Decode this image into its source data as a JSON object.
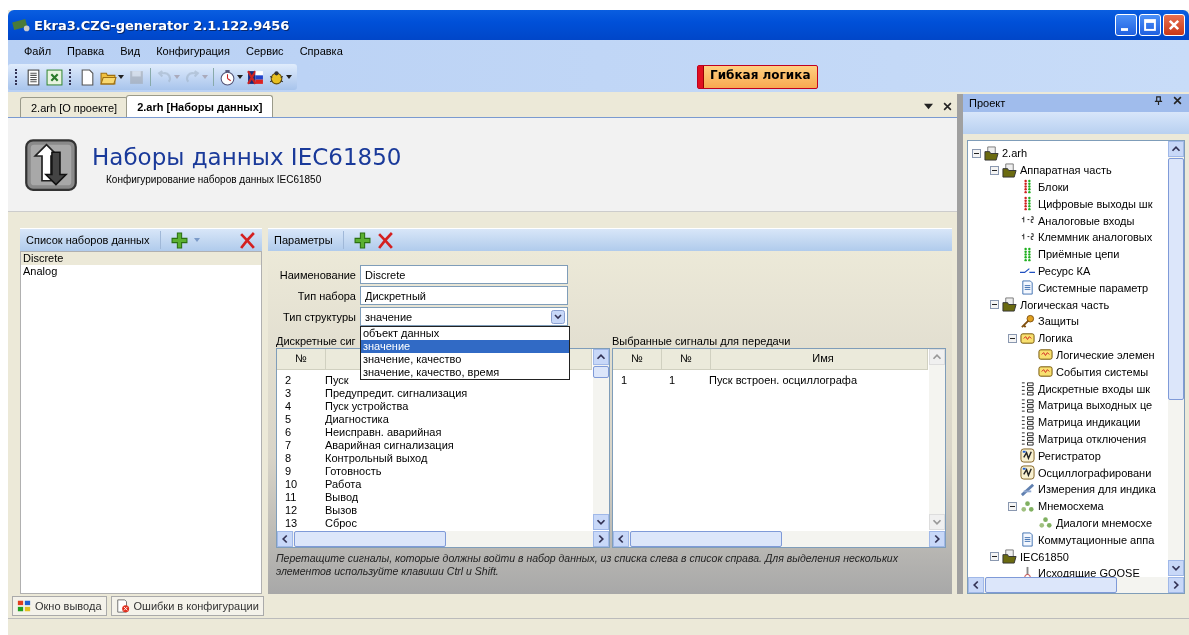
{
  "window": {
    "title": "Ekra3.CZG-generator 2.1.122.9456"
  },
  "menu": [
    "Файл",
    "Правка",
    "Вид",
    "Конфигурация",
    "Сервис",
    "Справка"
  ],
  "toolbar": [
    {
      "kind": "list",
      "disabled": false
    },
    {
      "kind": "excel",
      "disabled": false
    },
    {
      "kind": "new",
      "disabled": false
    },
    {
      "kind": "open",
      "disabled": false
    },
    {
      "kind": "save",
      "disabled": true
    },
    {
      "kind": "undo",
      "disabled": true
    },
    {
      "kind": "redo",
      "disabled": true
    },
    {
      "kind": "timer",
      "disabled": false
    },
    {
      "kind": "flag",
      "disabled": false
    },
    {
      "kind": "bug",
      "disabled": false
    }
  ],
  "mode_badge": "Гибкая логика",
  "doc_tabs": [
    {
      "label": "2.arh [О проекте]",
      "selected": false
    },
    {
      "label": "2.arh [Наборы данных]",
      "selected": true
    }
  ],
  "header": {
    "title": "Наборы данных IEC61850",
    "subtitle": "Конфигурирование наборов данных IEC61850"
  },
  "datasets": {
    "title": "Список наборов данных",
    "items": [
      {
        "label": "Discrete",
        "selected": true
      },
      {
        "label": "Analog",
        "selected": false
      }
    ]
  },
  "params": {
    "title": "Параметры",
    "fields": [
      {
        "label": "Наименование",
        "value": "Discrete",
        "kind": "text"
      },
      {
        "label": "Тип набора",
        "value": "Дискретный",
        "kind": "text"
      },
      {
        "label": "Тип структуры",
        "value": "значение",
        "kind": "combo"
      }
    ],
    "dropdown": [
      {
        "label": "объект данных",
        "selected": false
      },
      {
        "label": "значение",
        "selected": true
      },
      {
        "label": "значение, качество",
        "selected": false
      },
      {
        "label": "значение, качество, время",
        "selected": false
      }
    ],
    "source": {
      "title": "Дискретные сиг",
      "columns": [
        "№"
      ],
      "rows": [
        [
          "2",
          "Пуск"
        ],
        [
          "3",
          "Предупредит. сигнализация"
        ],
        [
          "4",
          "Пуск устройства"
        ],
        [
          "5",
          "Диагностика"
        ],
        [
          "6",
          "Неисправн. аварийная"
        ],
        [
          "7",
          "Аварийная сигнализация"
        ],
        [
          "8",
          "Контрольный выход"
        ],
        [
          "9",
          "Готовность"
        ],
        [
          "10",
          "Работа"
        ],
        [
          "11",
          "Вывод"
        ],
        [
          "12",
          "Вызов"
        ],
        [
          "13",
          "Сброс"
        ]
      ]
    },
    "target": {
      "title": "Выбранные сигналы для передачи",
      "columns": [
        "№",
        "№",
        "Имя"
      ],
      "rows": [
        [
          "1",
          "1",
          "Пуск встроен. осциллографа"
        ]
      ]
    },
    "hint": "Перетащите сигналы, которые должны войти в набор данных, из списка слева в список справа. Для выделения нескольких элементов используйте клавиши Ctrl и Shift."
  },
  "project": {
    "title": "Проект",
    "tree": [
      {
        "label": "2.arh",
        "kind": "folder",
        "expanded": true,
        "children": [
          {
            "label": "Аппаратная часть",
            "kind": "folder",
            "expanded": true,
            "children": [
              {
                "label": "Блоки",
                "kind": "output-leds"
              },
              {
                "label": "Цифровые выходы шк",
                "kind": "output-leds"
              },
              {
                "label": "Аналоговые входы",
                "kind": "numbers"
              },
              {
                "label": "Клеммник аналоговых",
                "kind": "numbers"
              },
              {
                "label": "Приёмные цепи",
                "kind": "input-leds"
              },
              {
                "label": "Ресурс КА",
                "kind": "switch"
              },
              {
                "label": "Системные параметр",
                "kind": "document"
              }
            ]
          },
          {
            "label": "Логическая часть",
            "kind": "folder",
            "expanded": true,
            "children": [
              {
                "label": "Защиты",
                "kind": "key"
              },
              {
                "label": "Логика",
                "kind": "chip",
                "expanded": true,
                "children": [
                  {
                    "label": "Логические элемен",
                    "kind": "chip"
                  },
                  {
                    "label": "События системы",
                    "kind": "chip"
                  }
                ]
              },
              {
                "label": "Дискретные входы шк",
                "kind": "matrix"
              },
              {
                "label": "Матрица выходных це",
                "kind": "matrix"
              },
              {
                "label": "Матрица индикации",
                "kind": "matrix"
              },
              {
                "label": "Матрица отключения",
                "kind": "matrix"
              },
              {
                "label": "Регистратор",
                "kind": "chart"
              },
              {
                "label": "Осциллографировани",
                "kind": "chart"
              },
              {
                "label": "Измерения для индика",
                "kind": "gauge"
              },
              {
                "label": "Мнемосхема",
                "kind": "scheme",
                "expanded": true,
                "children": [
                  {
                    "label": "Диалоги мнемосхе",
                    "kind": "scheme"
                  }
                ]
              },
              {
                "label": "Коммутационные аппа",
                "kind": "document"
              }
            ]
          },
          {
            "label": "IEC61850",
            "kind": "folder",
            "expanded": true,
            "children": [
              {
                "label": "Исходящие GOOSE",
                "kind": "goose"
              }
            ]
          }
        ]
      }
    ]
  },
  "bottom_tabs": [
    {
      "label": "Окно вывода",
      "kind": "output"
    },
    {
      "label": "Ошибки в конфигурации",
      "kind": "errors"
    }
  ]
}
